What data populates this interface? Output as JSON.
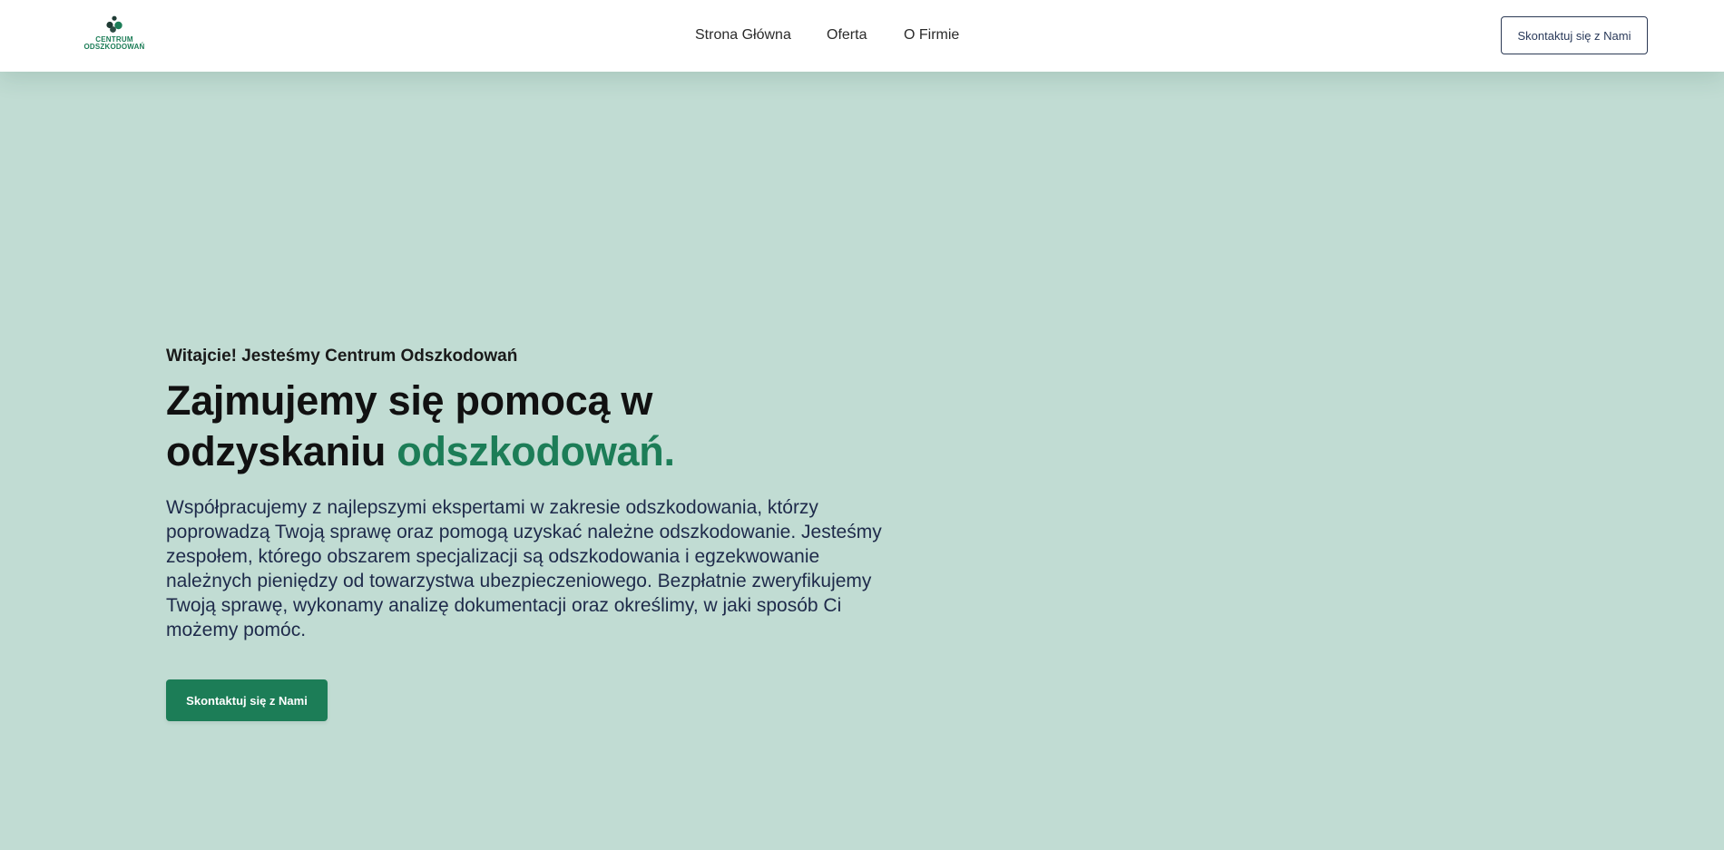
{
  "colors": {
    "accent": "#1c7d57",
    "hero_background": "#c1dcd3",
    "nav_background": "#ffffff",
    "text_dark": "#14223d"
  },
  "brand": {
    "logo_icon": "three-people-icon",
    "logo_line1": "CENTRUM",
    "logo_line2": "ODSZKODOWAŃ"
  },
  "nav": {
    "links": [
      {
        "label": "Strona Główna"
      },
      {
        "label": "Oferta"
      },
      {
        "label": "O Firmie"
      }
    ],
    "contact_label": "Skontaktuj się z Nami"
  },
  "hero": {
    "eyebrow": "Witajcie! Jesteśmy Centrum Odszkodowań",
    "headline_part1": "Zajmujemy się pomocą w odzyskaniu",
    "headline_accent": "odszkodowań.",
    "description": "Współpracujemy z najlepszymi ekspertami w zakresie odszkodowania, którzy poprowadzą Twoją sprawę oraz pomogą uzyskać należne odszkodowanie. Jesteśmy zespołem, którego obszarem specjalizacji są odszkodowania i egzekwowanie należnych pieniędzy od towarzystwa ubezpieczeniowego. Bezpłatnie zweryfikujemy Twoją sprawę, wykonamy analizę dokumentacji oraz określimy, w jaki sposób Ci możemy pomóc.",
    "cta_label": "Skontaktuj się z Nami"
  }
}
